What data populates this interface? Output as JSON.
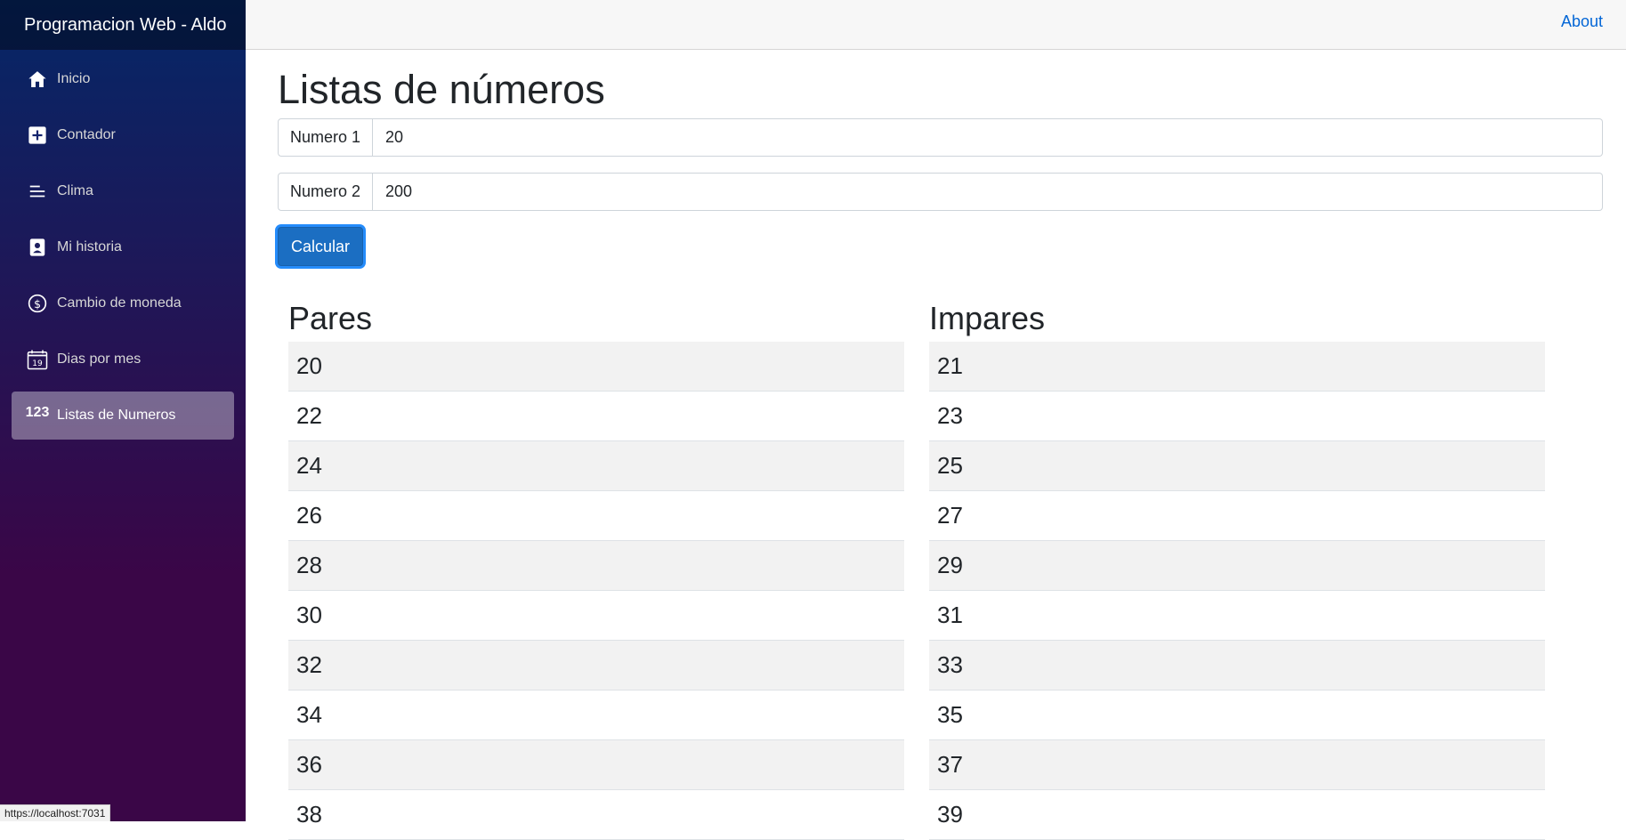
{
  "sidebar": {
    "brand": "Programacion Web - Aldo",
    "items": [
      {
        "label": "Inicio",
        "icon": "home-icon"
      },
      {
        "label": "Contador",
        "icon": "plus-square-icon"
      },
      {
        "label": "Clima",
        "icon": "list-lines-icon"
      },
      {
        "label": "Mi historia",
        "icon": "person-card-icon"
      },
      {
        "label": "Cambio de moneda",
        "icon": "dollar-coin-icon"
      },
      {
        "label": "Dias por mes",
        "icon": "calendar-icon"
      },
      {
        "label": "Listas de Numeros",
        "icon": "123",
        "active": true
      }
    ]
  },
  "topbar": {
    "about": "About"
  },
  "main": {
    "title": "Listas de números",
    "fields": [
      {
        "label": "Numero 1",
        "value": "20"
      },
      {
        "label": "Numero 2",
        "value": "200"
      }
    ],
    "button": "Calcular"
  },
  "lists": {
    "pares": {
      "title": "Pares",
      "items": [
        "20",
        "22",
        "24",
        "26",
        "28",
        "30",
        "32",
        "34",
        "36",
        "38"
      ]
    },
    "impares": {
      "title": "Impares",
      "items": [
        "21",
        "23",
        "25",
        "27",
        "29",
        "31",
        "33",
        "35",
        "37",
        "39"
      ]
    }
  },
  "status_bar": {
    "url": "https://localhost:7031"
  },
  "colors": {
    "accent": "#1b6ec2",
    "link": "#0366d6",
    "sidebar_top": "#052767",
    "sidebar_bottom": "#3a0647"
  }
}
